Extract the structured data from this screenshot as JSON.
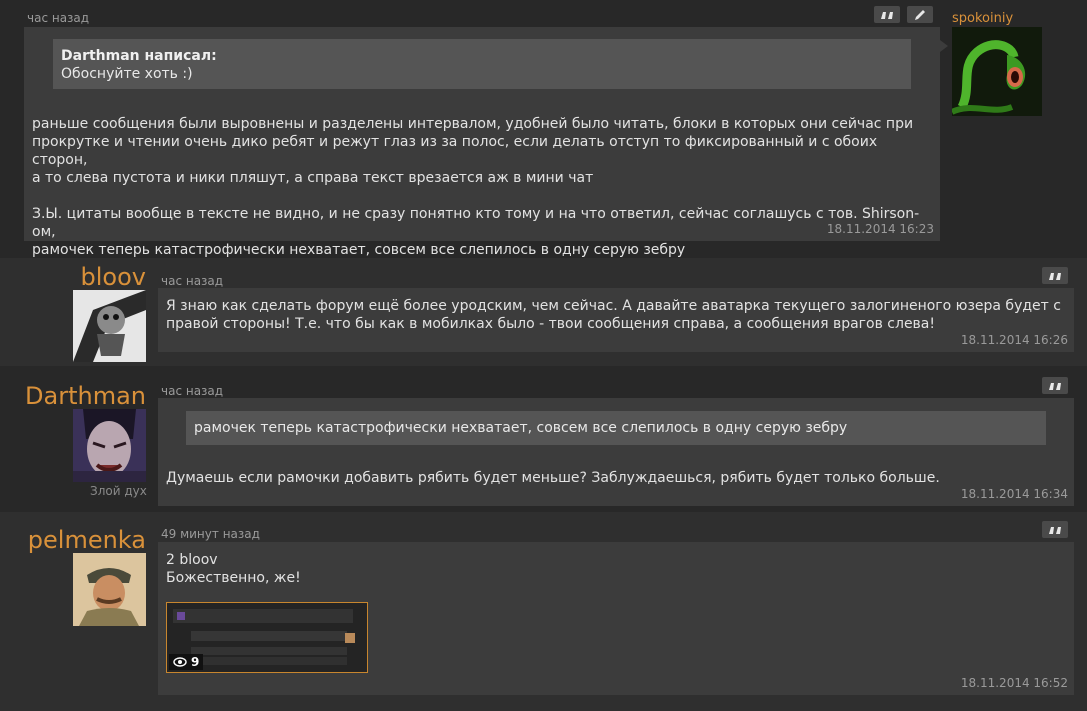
{
  "posts": [
    {
      "author": "spokoiniy",
      "time": "час назад",
      "quote_author": "Darthman написал:",
      "quote_text": "Обоснуйте хоть :)",
      "paragraph1_line1": "раньше сообщения были выровнены и разделены интервалом, удобней было читать, блоки в которых они сейчас при",
      "paragraph1_line2": "прокрутке и чтении очень дико ребят и режут глаз из за полос, если делать отступ то фиксированный и с обоих сторон,",
      "paragraph1_line3": "а то слева пустота и ники пляшут, а справа текст врезается аж в мини чат",
      "paragraph2_line1": "З.Ы. цитаты вообще в тексте не видно, и не сразу понятно кто тому и на что ответил, сейчас соглашусь с тов. Shirson-ом,",
      "paragraph2_line2": "рамочек теперь катастрофически нехватает, совсем все слепилось в одну серую зебру",
      "date": "18.11.2014 16:23"
    },
    {
      "author": "bloov",
      "time": "час назад",
      "line1": "Я знаю как сделать форум ещё более уродским, чем сейчас. А давайте аватарка текущего залогиненого юзера будет с",
      "line2": "правой стороны! Т.е. что бы как в мобилках было - твои сообщения справа, а сообщения врагов слева!",
      "date": "18.11.2014 16:26"
    },
    {
      "author": "Darthman",
      "subtitle": "Злой дух",
      "time": "час назад",
      "quote_text": "рамочек теперь катастрофически нехватает, совсем все слепилось в одну серую зебру",
      "text": "Думаешь если рамочки добавить рябить будет меньше? Заблуждаешься, рябить будет только больше.",
      "date": "18.11.2014 16:34"
    },
    {
      "author": "pelmenka",
      "time": "49 минут назад",
      "line1": "2 bloov",
      "line2": "Божественно, же!",
      "image_views": "9",
      "date": "18.11.2014 16:52"
    }
  ],
  "icons": {
    "quote": "quote-icon",
    "edit": "pencil-icon",
    "views": "eye-icon"
  },
  "colors": {
    "background": "#282828",
    "bubble": "#3c3c3c",
    "quote_box": "#555555",
    "username": "#d9913a",
    "thumbnail_border": "#c8862e"
  }
}
